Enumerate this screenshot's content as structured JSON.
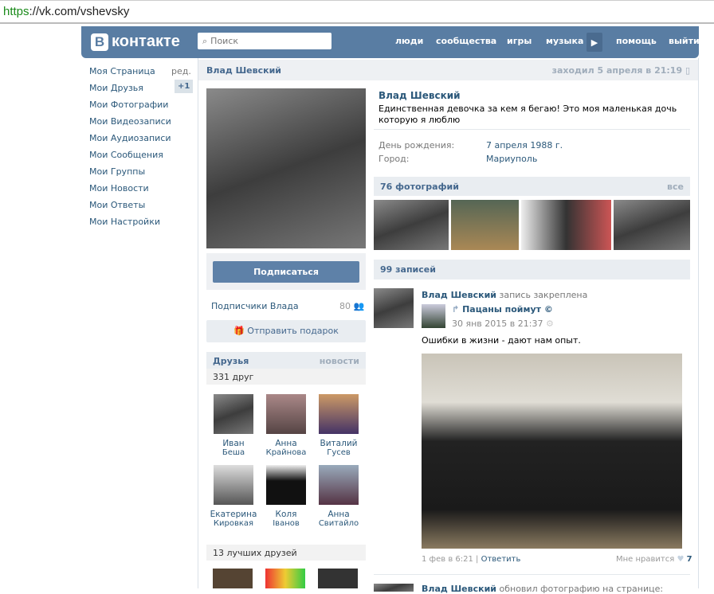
{
  "browser": {
    "url_scheme": "https",
    "url_rest": "://vk.com/vshevsky"
  },
  "header": {
    "logo": "контакте",
    "logo_letter": "В",
    "search_placeholder": "Поиск",
    "nav": [
      "люди",
      "сообщества",
      "игры",
      "музыка",
      "помощь",
      "выйти"
    ]
  },
  "sidebar": {
    "items": [
      {
        "label": "Моя Страница",
        "extra": "ред."
      },
      {
        "label": "Мои Друзья",
        "extra": "+1"
      },
      {
        "label": "Мои Фотографии"
      },
      {
        "label": "Мои Видеозаписи"
      },
      {
        "label": "Мои Аудиозаписи"
      },
      {
        "label": "Мои Сообщения"
      },
      {
        "label": "Мои Группы"
      },
      {
        "label": "Мои Новости"
      },
      {
        "label": "Мои Ответы"
      },
      {
        "label": "Мои Настройки"
      }
    ]
  },
  "profile": {
    "name": "Влад Шевский",
    "last_seen": "заходил 5 апреля в 21:19",
    "status": "Единственная девочка за кем я бегаю! Это моя маленькая дочь которую я люблю",
    "birthday_label": "День рождения:",
    "birthday": "7 апреля 1988 г.",
    "city_label": "Город:",
    "city": "Мариуполь"
  },
  "left": {
    "subscribe": "Подписаться",
    "followers_label": "Подписчики Влада",
    "followers_count": "80",
    "gift": "Отправить подарок",
    "friends_title": "Друзья",
    "friends_news": "новости",
    "friends_count": "331 друг",
    "friends": [
      {
        "first": "Иван",
        "last": "Беша"
      },
      {
        "first": "Анна",
        "last": "Крайнова"
      },
      {
        "first": "Виталий",
        "last": "Гусев"
      },
      {
        "first": "Екатерина",
        "last": "Кировкая"
      },
      {
        "first": "Коля",
        "last": "Iванов"
      },
      {
        "first": "Анна",
        "last": "Свитайло"
      }
    ],
    "best_friends": "13 лучших друзей"
  },
  "photos": {
    "title": "76 фотографий",
    "all": "все"
  },
  "wall": {
    "title": "99 записей",
    "post": {
      "author": "Влад Шевский",
      "pinned": "запись закреплена",
      "repost_from": "Пацаны поймут ©",
      "repost_date": "30 янв 2015 в 21:37",
      "text": "Ошибки в жизни - дают нам опыт.",
      "date": "1 фев в 6:21",
      "reply": "Ответить",
      "like_label": "Мне нравится",
      "likes": "7"
    },
    "post2": {
      "author": "Влад Шевский",
      "action": "обновил фотографию на странице:"
    }
  }
}
